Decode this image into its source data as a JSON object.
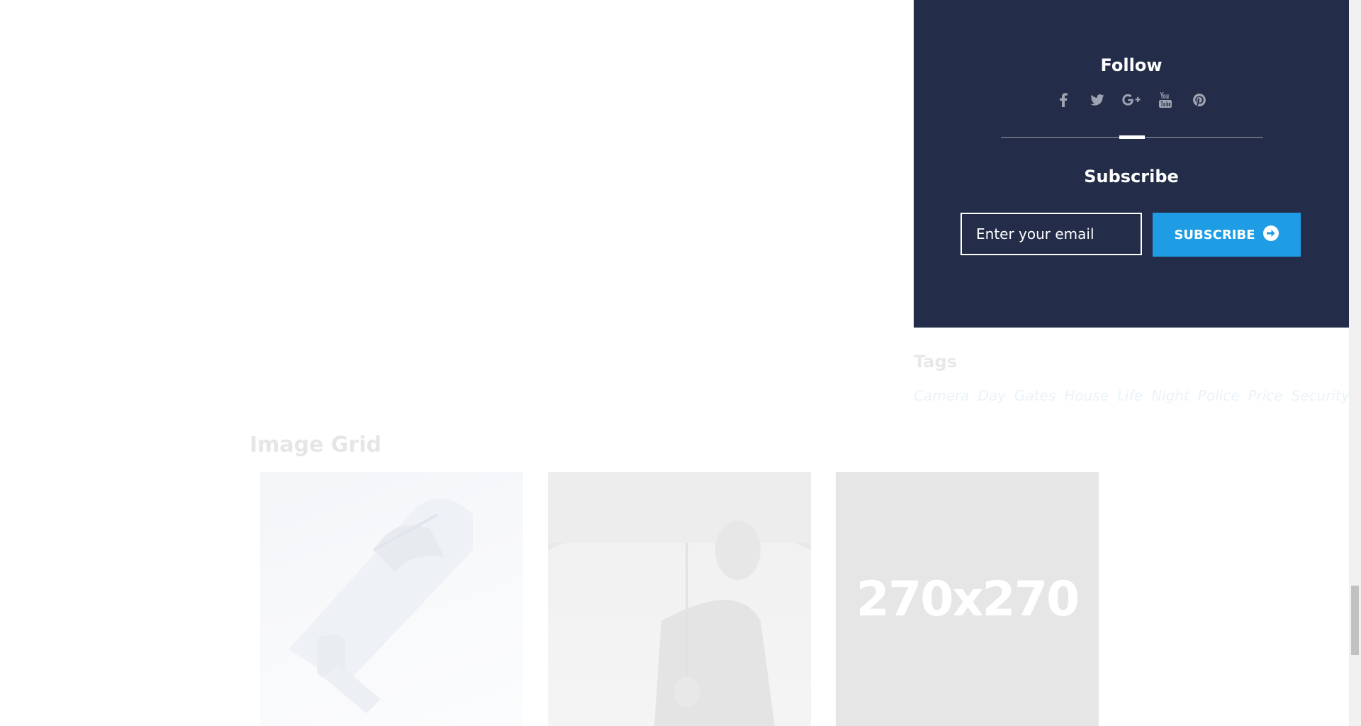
{
  "follow_widget": {
    "title": "Follow",
    "social_icons": [
      "facebook-icon",
      "twitter-icon",
      "google-plus-icon",
      "youtube-icon",
      "pinterest-icon"
    ],
    "panel_color": "#232d49",
    "icon_color": "#9ea3b1"
  },
  "subscribe_widget": {
    "title": "Subscribe",
    "email_placeholder": "Enter your email",
    "button_label": "SUBSCRIBE",
    "button_icon": "arrow-circle-right-icon",
    "button_color": "#1e9de4"
  },
  "tags_widget": {
    "title": "Tags",
    "tags": [
      "Camera",
      "Day",
      "Gates",
      "House",
      "Life",
      "Night",
      "Police",
      "Price",
      "Security"
    ]
  },
  "image_grid": {
    "title": "Image Grid",
    "tiles": [
      {
        "image": "security-camera-photo"
      },
      {
        "image": "man-with-umbrella-photo"
      },
      {
        "placeholder_text": "270x270"
      }
    ]
  }
}
